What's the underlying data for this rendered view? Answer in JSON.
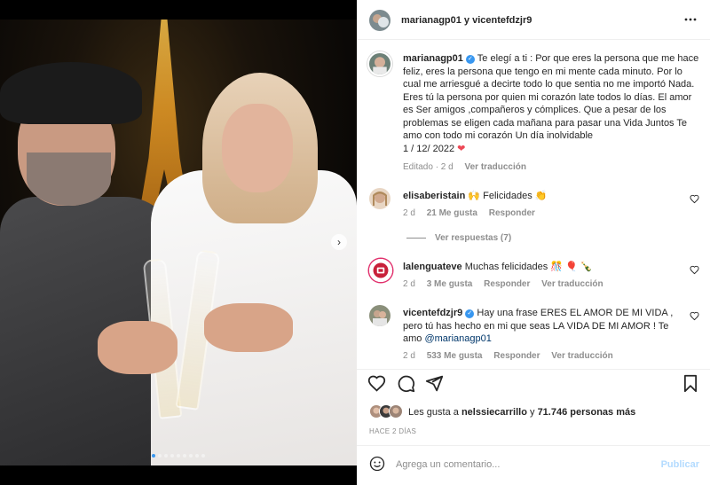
{
  "header": {
    "title": "marianagp01 y vicentefdzjr9",
    "more_icon": "more-horizontal-icon"
  },
  "caption": {
    "username": "marianagp01",
    "text": "Te elegí a ti : Por que eres la persona que me hace feliz, eres la persona que tengo en mi mente cada minuto. Por lo cual me arriesgué a decirte todo lo que sentia no me importó Nada. Eres tú la persona por quien mi corazón late todos lo días. El amor es Ser amigos ,compañeros y cómplices. Que a pesar de los problemas se eligen cada mañana para pasar una Vida Juntos Te amo con todo mi corazón Un día inolvidable",
    "date_line": "1 / 12/ 2022",
    "heart_emoji": "❤",
    "edited": "Editado · 2 d",
    "translate": "Ver traducción"
  },
  "comments": [
    {
      "username": "elisaberistain",
      "text": "🙌 Felicidades 👏",
      "age": "2 d",
      "likes": "21 Me gusta",
      "reply": "Responder",
      "view_replies": "Ver respuestas (7)"
    },
    {
      "username": "lalenguateve",
      "text": "Muchas felicidades 🎊 🎈 🍾",
      "age": "2 d",
      "likes": "3 Me gusta",
      "reply": "Responder",
      "translate": "Ver traducción"
    },
    {
      "username": "vicentefdzjr9",
      "text": "Hay una frase ERES EL AMOR DE MI VIDA , pero tú has hecho en mi que seas LA VIDA DE MI AMOR ! Te amo",
      "mention": "@marianagp01",
      "age": "2 d",
      "likes": "533 Me gusta",
      "reply": "Responder",
      "translate": "Ver traducción"
    }
  ],
  "likes": {
    "prefix": "Les gusta a",
    "user": "nelssiecarrillo",
    "connector": "y",
    "others": "71.746 personas más"
  },
  "timestamp": "HACE 2 DÍAS",
  "add_comment": {
    "placeholder": "Agrega un comentario...",
    "publish": "Publicar"
  },
  "colors": {
    "link_blue": "#00376b",
    "verified_blue": "#3897f0",
    "heart_red": "#ed4956",
    "muted": "#8e8e8e",
    "publish_disabled": "#b3dbff"
  },
  "carousel": {
    "slides": 9,
    "active": 1
  }
}
